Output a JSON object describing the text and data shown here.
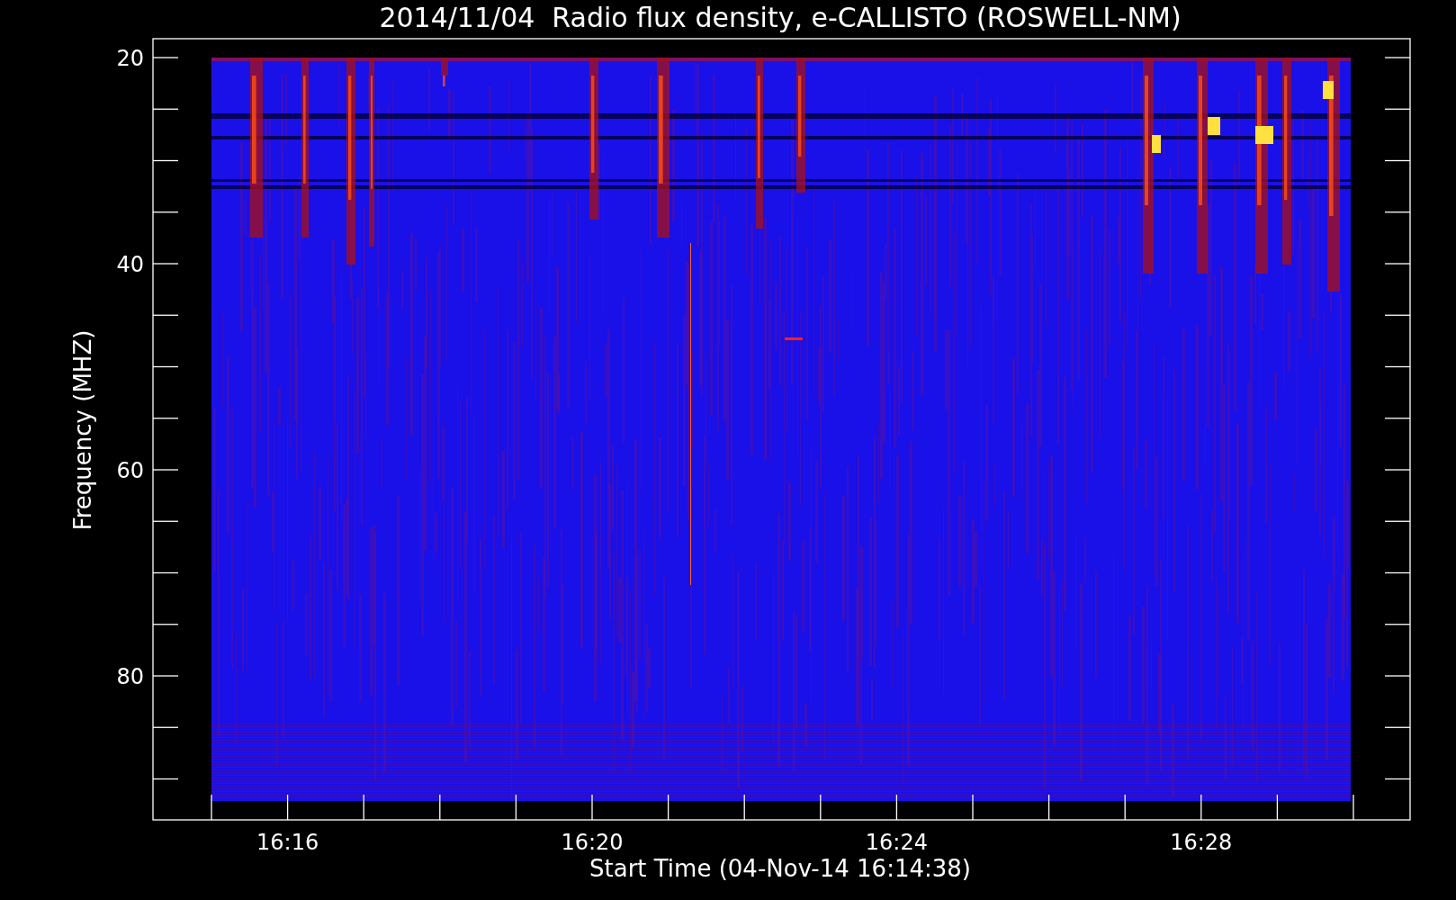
{
  "title": "2014/11/04  Radio flux density, e-CALLISTO (ROSWELL-NM)",
  "y_axis": {
    "label": "Frequency (MHZ)",
    "ticks": [
      "20",
      "40",
      "60",
      "80"
    ]
  },
  "x_axis": {
    "label": "Start Time (04-Nov-14 16:14:38)",
    "ticks": [
      "16:16",
      "16:20",
      "16:24",
      "16:28"
    ]
  }
}
